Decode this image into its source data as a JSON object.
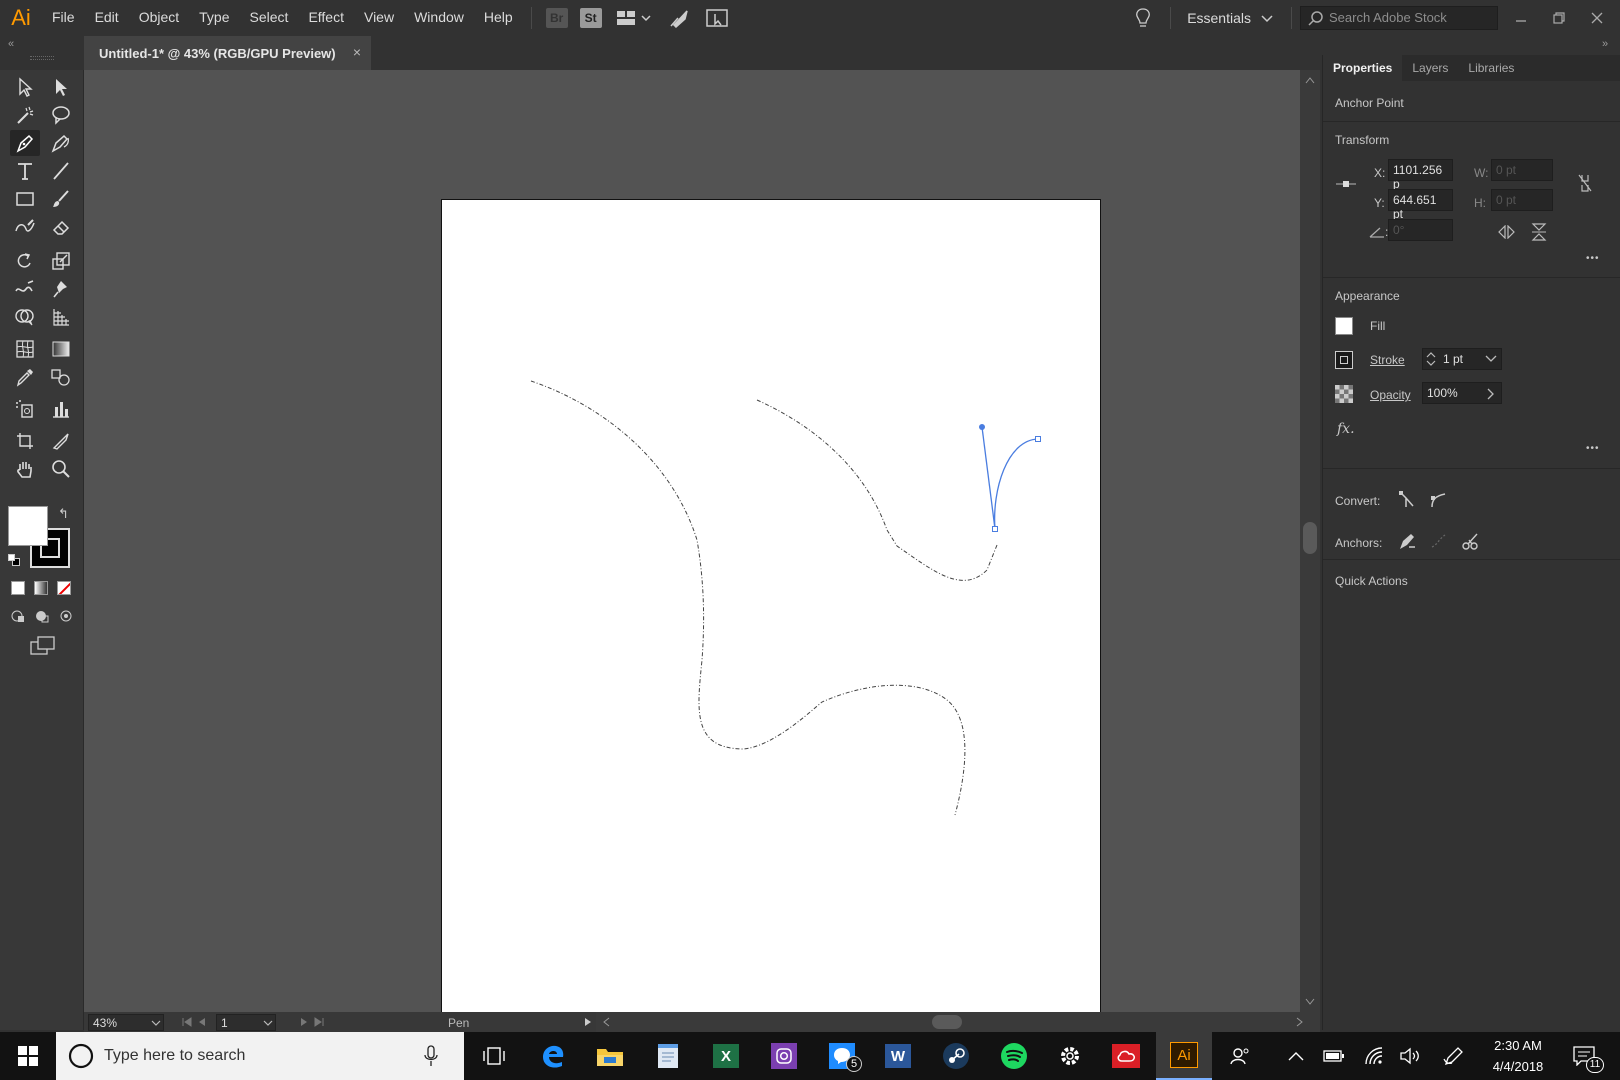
{
  "app": {
    "logo": "Ai",
    "accent": "#ff9a00"
  },
  "menu": [
    "File",
    "Edit",
    "Object",
    "Type",
    "Select",
    "Effect",
    "View",
    "Window",
    "Help"
  ],
  "bridge_label": "Br",
  "stock_label": "St",
  "workspace": "Essentials",
  "stock_search_placeholder": "Search Adobe Stock",
  "document_tab": {
    "title": "Untitled-1* @ 43% (RGB/GPU Preview)",
    "close": "×"
  },
  "panel": {
    "tabs": [
      "Properties",
      "Layers",
      "Libraries"
    ],
    "selection_type": "Anchor Point",
    "transform": {
      "heading": "Transform",
      "x_label": "X:",
      "x_value": "1101.256 p",
      "y_label": "Y:",
      "y_value": "644.651 pt",
      "w_label": "W:",
      "w_value": "0 pt",
      "h_label": "H:",
      "h_value": "0 pt",
      "angle_value": "0°"
    },
    "appearance": {
      "heading": "Appearance",
      "fill_label": "Fill",
      "stroke_label": "Stroke",
      "stroke_value": "1 pt",
      "opacity_label": "Opacity",
      "opacity_value": "100%",
      "fx_label": "fx."
    },
    "convert_label": "Convert:",
    "anchors_label": "Anchors:",
    "quick_actions": "Quick Actions",
    "more": "•••"
  },
  "status": {
    "zoom": "43%",
    "artboard": "1",
    "tool": "Pen"
  },
  "taskbar": {
    "search_placeholder": "Type here to search",
    "time": "2:30 AM",
    "date": "4/4/2018",
    "messenger_badge": "5",
    "notification_count": "11",
    "illustrator_label": "Ai",
    "excel_label": "X",
    "word_label": "W"
  }
}
